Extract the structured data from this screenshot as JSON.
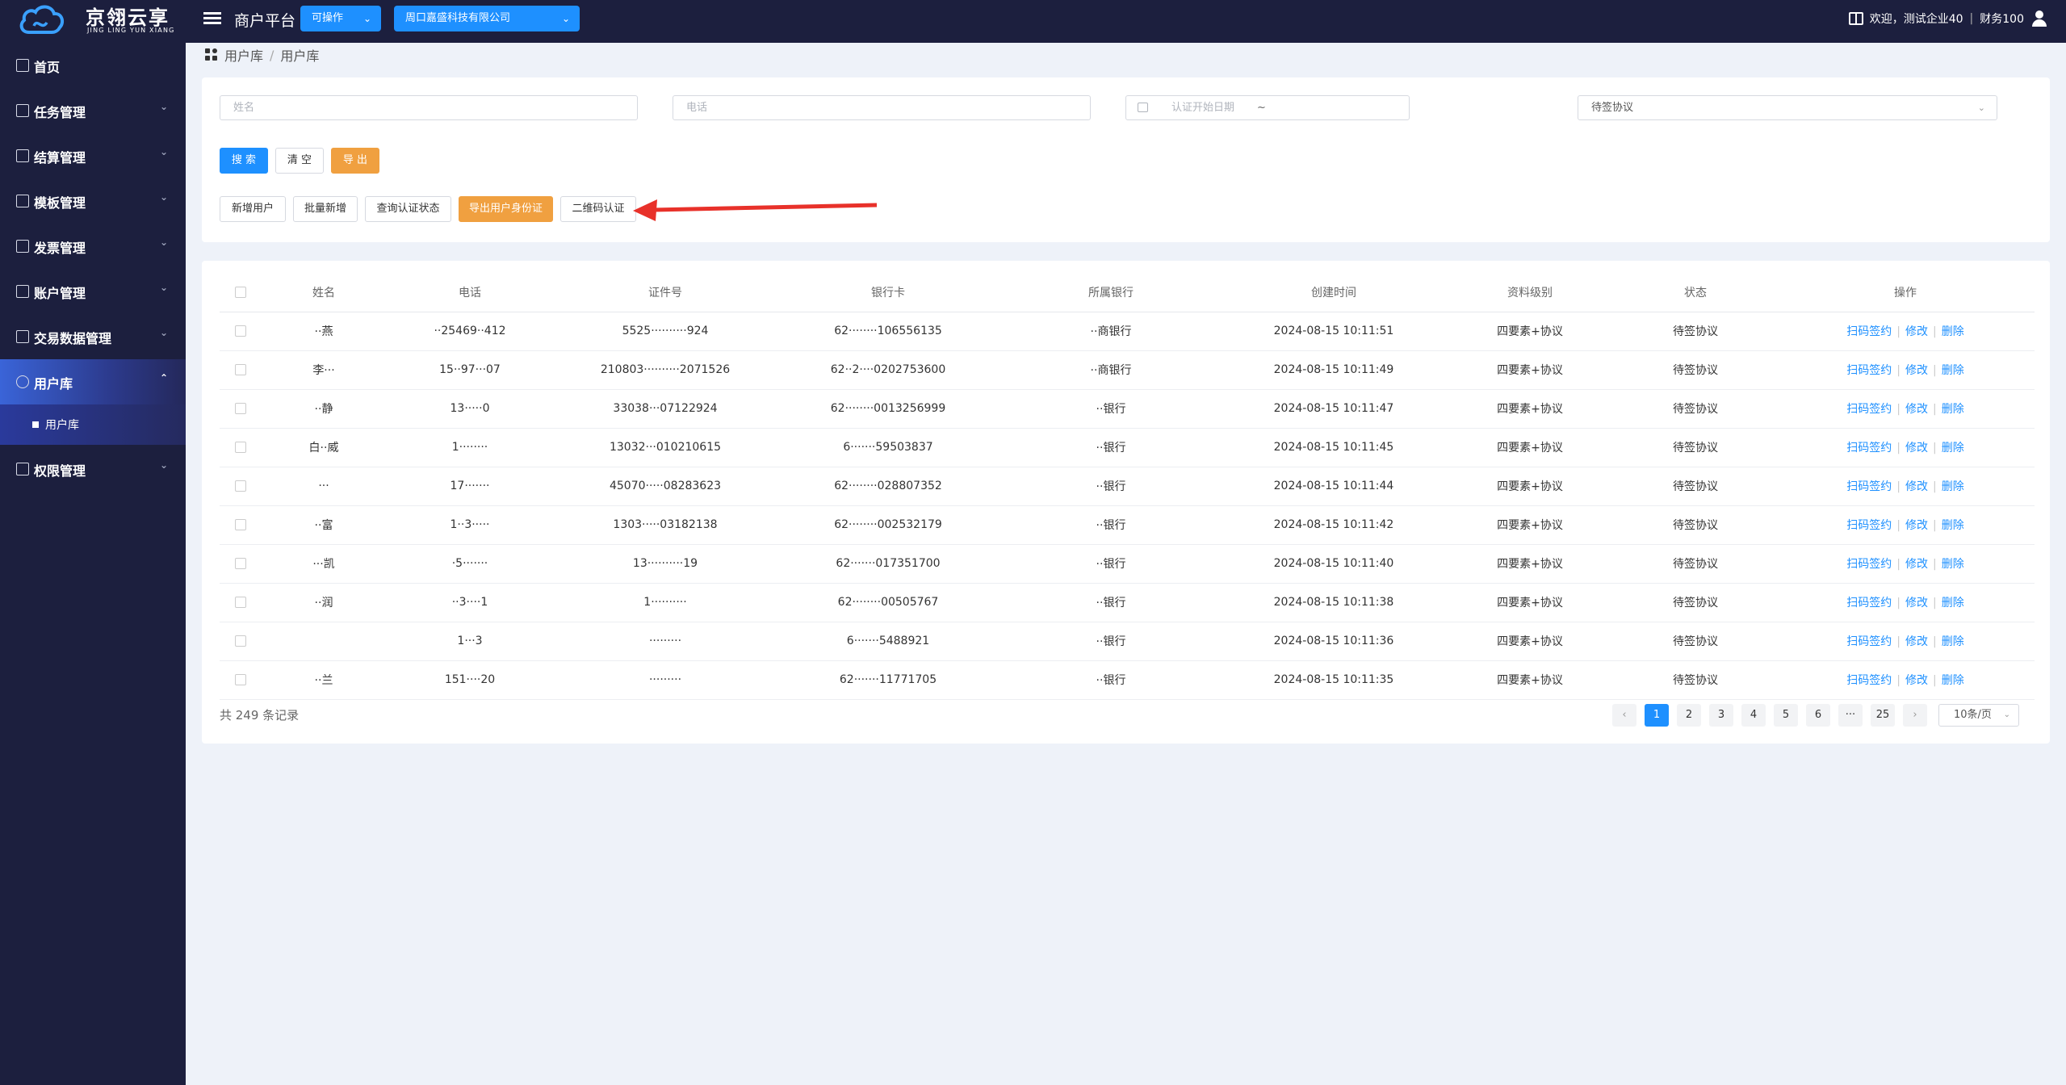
{
  "app": {
    "logo_cn": "京翎云享",
    "logo_en": "JING LING YUN XIANG",
    "platform_title": "商户平台",
    "operate_select": "可操作",
    "company_select": "周口嘉盛科技有限公司",
    "welcome_text": "欢迎，测试企业40",
    "user_name": "财务100"
  },
  "sidebar": {
    "items": [
      {
        "label": "首页",
        "icon": "home-icon"
      },
      {
        "label": "任务管理",
        "icon": "task-icon"
      },
      {
        "label": "结算管理",
        "icon": "settlement-icon"
      },
      {
        "label": "模板管理",
        "icon": "template-icon"
      },
      {
        "label": "发票管理",
        "icon": "invoice-icon"
      },
      {
        "label": "账户管理",
        "icon": "account-icon"
      },
      {
        "label": "交易数据管理",
        "icon": "bank-icon"
      },
      {
        "label": "用户库",
        "icon": "user-icon"
      },
      {
        "label": "权限管理",
        "icon": "permission-icon"
      }
    ],
    "sub_item": "用户库"
  },
  "breadcrumb": {
    "level1": "用户库",
    "sep": "/",
    "level2": "用户库"
  },
  "search": {
    "name_placeholder": "姓名",
    "phone_placeholder": "电话",
    "date_placeholder": "认证开始日期",
    "date_separator": "~",
    "status_value": "待签协议",
    "search_btn": "搜 索",
    "clear_btn": "清 空",
    "export_btn": "导 出"
  },
  "actions": {
    "add_user": "新增用户",
    "batch_add": "批量新增",
    "query_status": "查询认证状态",
    "export_id": "导出用户身份证",
    "qr_auth": "二维码认证"
  },
  "table": {
    "headers": [
      "姓名",
      "电话",
      "证件号",
      "银行卡",
      "所属银行",
      "创建时间",
      "资料级别",
      "状态",
      "操作"
    ],
    "rows": [
      {
        "name": "··燕",
        "phone": "··25469··412",
        "id": "5525··········924",
        "card": "62········106556135",
        "bank": "··商银行",
        "created": "2024-08-15 10:11:51",
        "level": "四要素+协议",
        "status": "待签协议"
      },
      {
        "name": "李···",
        "phone": "15··97···07",
        "id": "210803··········2071526",
        "card": "62··2····0202753600",
        "bank": "··商银行",
        "created": "2024-08-15 10:11:49",
        "level": "四要素+协议",
        "status": "待签协议"
      },
      {
        "name": "··静",
        "phone": "13·····0",
        "id": "33038···07122924",
        "card": "62········0013256999",
        "bank": "··银行",
        "created": "2024-08-15 10:11:47",
        "level": "四要素+协议",
        "status": "待签协议"
      },
      {
        "name": "白··威",
        "phone": "1········",
        "id": "13032···010210615",
        "card": "6·······59503837",
        "bank": "··银行",
        "created": "2024-08-15 10:11:45",
        "level": "四要素+协议",
        "status": "待签协议"
      },
      {
        "name": "···",
        "phone": "17·······",
        "id": "45070·····08283623",
        "card": "62········028807352",
        "bank": "··银行",
        "created": "2024-08-15 10:11:44",
        "level": "四要素+协议",
        "status": "待签协议"
      },
      {
        "name": "··富",
        "phone": "1··3·····",
        "id": "1303·····03182138",
        "card": "62········002532179",
        "bank": "··银行",
        "created": "2024-08-15 10:11:42",
        "level": "四要素+协议",
        "status": "待签协议"
      },
      {
        "name": "···凯",
        "phone": "·5·······",
        "id": "13··········19",
        "card": "62·······017351700",
        "bank": "··银行",
        "created": "2024-08-15 10:11:40",
        "level": "四要素+协议",
        "status": "待签协议"
      },
      {
        "name": "··润",
        "phone": "··3····1",
        "id": "1··········",
        "card": "62········00505767",
        "bank": "··银行",
        "created": "2024-08-15 10:11:38",
        "level": "四要素+协议",
        "status": "待签协议"
      },
      {
        "name": "",
        "phone": "1···3",
        "id": "·········",
        "card": "6·······5488921",
        "bank": "··银行",
        "created": "2024-08-15 10:11:36",
        "level": "四要素+协议",
        "status": "待签协议"
      },
      {
        "name": "··兰",
        "phone": "151····20",
        "id": "·········",
        "card": "62·······11771705",
        "bank": "··银行",
        "created": "2024-08-15 10:11:35",
        "level": "四要素+协议",
        "status": "待签协议"
      }
    ],
    "op_sign": "扫码签约",
    "op_edit": "修改",
    "op_delete": "删除",
    "op_sep": "|"
  },
  "pagination": {
    "total_text": "共 249 条记录",
    "prev": "‹",
    "pages": [
      "1",
      "2",
      "3",
      "4",
      "5",
      "6",
      "···",
      "25"
    ],
    "next": "›",
    "page_size": "10条/页"
  },
  "colors": {
    "sidebar_bg": "#1c1f3e",
    "primary": "#1e90ff",
    "orange": "#f0a040",
    "annotation_arrow": "#e8312a"
  }
}
